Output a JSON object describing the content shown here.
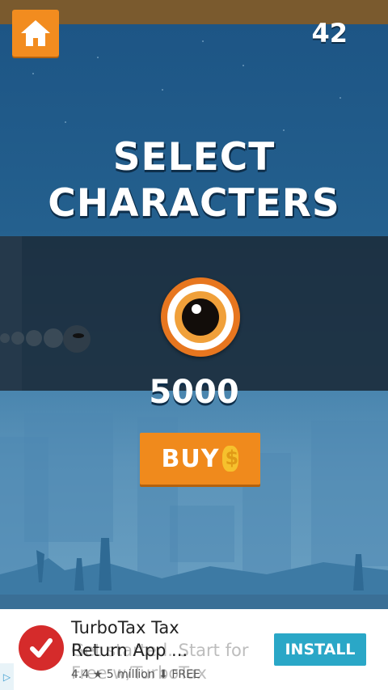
{
  "header": {
    "score": "42"
  },
  "title": {
    "line1": "SELECT",
    "line2": "CHARACTERS"
  },
  "character": {
    "price": "5000"
  },
  "buy": {
    "label": "BUY"
  },
  "ad": {
    "title": "TurboTax Tax Return App ...",
    "subtitle": "Get started. Start for Free w/TurboTax",
    "rating": "4.4",
    "installs": "5 million",
    "price": "FREE",
    "install_label": "INSTALL"
  },
  "colors": {
    "accent": "#f28c1f",
    "sky": "#1d5585",
    "panel": "#1c2e3e",
    "install": "#2aa7c7"
  }
}
